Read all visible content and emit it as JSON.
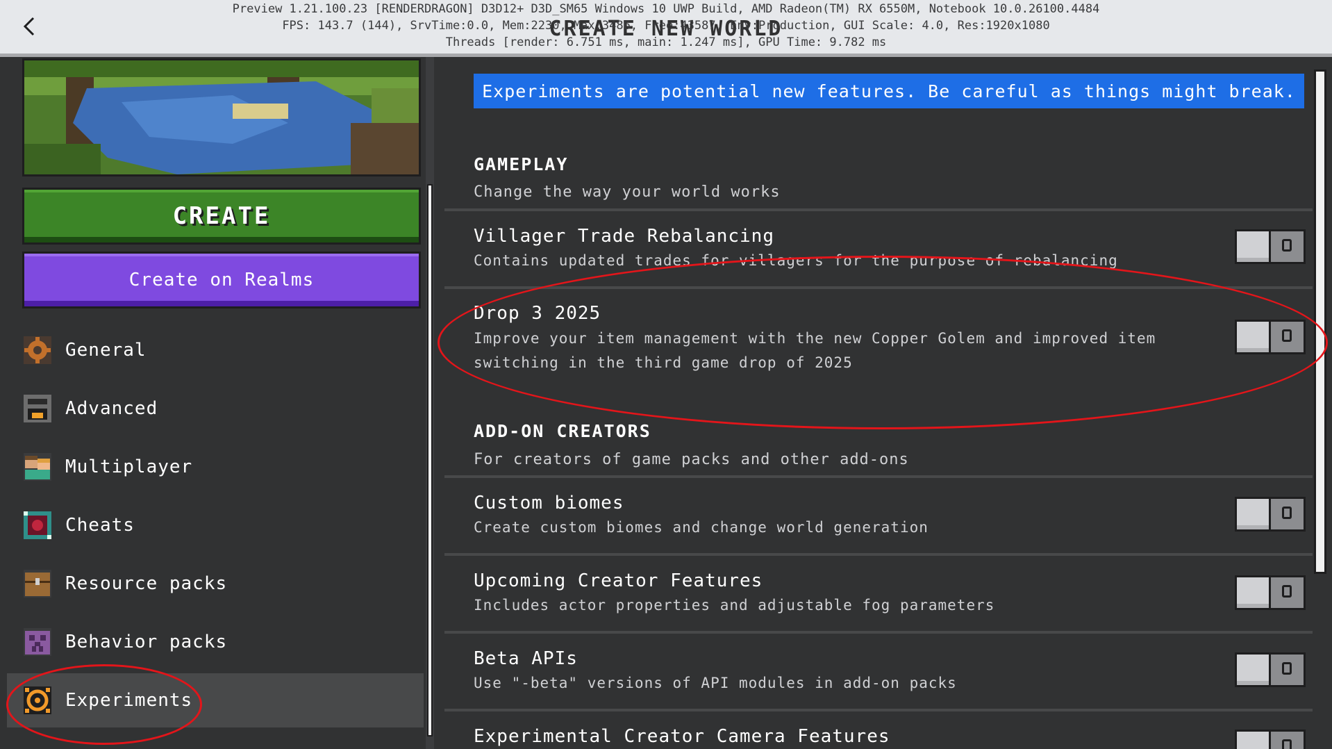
{
  "header": {
    "title": "CREATE NEW WORLD",
    "debug_line1": "Preview 1.21.100.23 [RENDERDRAGON] D3D12+ D3D_SM65 Windows 10 UWP Build, AMD Radeon(TM) RX 6550M, Notebook 10.0.26100.4484",
    "debug_line2": "FPS: 143.7 (144), SrvTime:0.0, Mem:2230, Max:3486, Free:43587, Env:Production, GUI Scale: 4.0, Res:1920x1080",
    "debug_line3": "Threads [render: 6.751 ms, main: 1.247 ms], GPU Time: 9.782 ms",
    "back_icon": "chevron-left-icon"
  },
  "left": {
    "create_label": "CREATE",
    "realms_label": "Create on Realms",
    "nav": [
      {
        "label": "General",
        "icon": "gear-icon"
      },
      {
        "label": "Advanced",
        "icon": "furnace-icon"
      },
      {
        "label": "Multiplayer",
        "icon": "players-icon"
      },
      {
        "label": "Cheats",
        "icon": "command-block-icon"
      },
      {
        "label": "Resource packs",
        "icon": "chest-icon"
      },
      {
        "label": "Behavior packs",
        "icon": "creeper-icon"
      },
      {
        "label": "Experiments",
        "icon": "experiments-icon",
        "selected": true
      }
    ]
  },
  "right": {
    "banner": "Experiments are potential new features. Be careful as things might break.",
    "gameplay": {
      "heading": "GAMEPLAY",
      "subtitle": "Change the way your world works",
      "settings": [
        {
          "title": "Villager Trade Rebalancing",
          "desc": "Contains updated trades for villagers for the purpose of rebalancing",
          "enabled": false
        },
        {
          "title": "Drop 3 2025",
          "desc": "Improve your item management with the new Copper Golem and improved item switching in the third game drop of 2025",
          "enabled": false
        }
      ]
    },
    "addon": {
      "heading": "ADD-ON CREATORS",
      "subtitle": "For creators of game packs and other add-ons",
      "settings": [
        {
          "title": "Custom biomes",
          "desc": "Create custom biomes and change world generation",
          "enabled": false
        },
        {
          "title": "Upcoming Creator Features",
          "desc": "Includes actor properties and adjustable fog parameters",
          "enabled": false
        },
        {
          "title": "Beta APIs",
          "desc": "Use \"-beta\" versions of API modules in add-on packs",
          "enabled": false
        },
        {
          "title": "Experimental Creator Camera Features",
          "desc": "",
          "enabled": false
        }
      ]
    }
  },
  "colors": {
    "accent_create": "#3c8527",
    "accent_realms": "#7f4ae0",
    "banner": "#1e6ee6",
    "annotation_ring": "#e3151a"
  }
}
